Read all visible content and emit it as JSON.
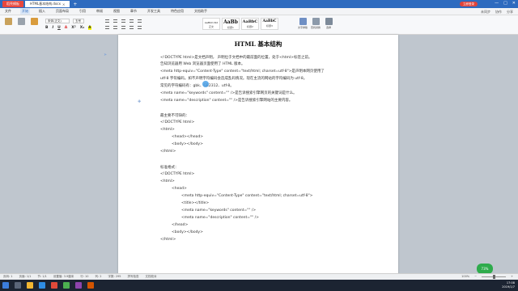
{
  "titlebar": {
    "app_tab": "稻壳模板",
    "doc_tab": "HTML基本结构.docx",
    "login": "立即登录",
    "controls": [
      "—",
      "□",
      "✕"
    ]
  },
  "menubar": {
    "items": [
      "文件",
      "开始",
      "插入",
      "页面布局",
      "引用",
      "审阅",
      "视图",
      "章节",
      "开发工具",
      "特色应用",
      "文档助手"
    ],
    "active_index": 1,
    "right": [
      "未同步",
      "协作",
      "分享"
    ]
  },
  "ribbon": {
    "font_name": "宋体(正文)",
    "font_size": "五号",
    "format_buttons": [
      "B",
      "I",
      "U",
      "A",
      "X²",
      "X₂",
      "A"
    ],
    "styles": [
      {
        "sample": "AaBbCcDd",
        "name": "正文"
      },
      {
        "sample": "AaBb",
        "name": "标题1"
      },
      {
        "sample": "AaBbC",
        "name": "标题2"
      },
      {
        "sample": "AaBbC",
        "name": "标题3"
      }
    ],
    "right_buttons": [
      "文字排版",
      "查找替换",
      "选择"
    ]
  },
  "document": {
    "title": "HTML 基本结构",
    "lines": [
      "<!DOCTYPE html>是文档声明，  声明位于文档中的最前面的位置，处于<html>标签之前。",
      "告知浏览器用 Web 浏览器页面使用了 HTML 版本。",
      "<meta http-equiv=\"Content-Type\" content=\"text/html; charset=utf-8\">是声明本网页使用了",
      "utf-8 字符编码。如不声明字符编码会造成乱码情况。现在主流的网站的字符编码为 utf-8。",
      "常见的字符编码有：gbk、GB2312、utf-8。",
      "<meta name=\"keywords\" content=\"\" />是告诉搜索引擎网页的关键词是什么。",
      "<meta name=\"description\" content=\"\" />是告诉搜索引擎网站的主要内容。",
      "",
      "最主要不可缺的：",
      "<!DOCTYPE html>",
      "<html>",
      "<head></head>",
      "<body></body>",
      "</html>",
      "",
      "标准格式：",
      "<!DOCTYPE html>",
      "<html>",
      "<head>",
      "<meta http-equiv=\"Content-Type\" content=\"text/html; charset=utf-8\">",
      "<title></title>",
      "<meta name=\"keywords\" content=\"\" />",
      "<meta name=\"description\" content=\"\" />",
      "</head>",
      "<body></body>",
      "</html>"
    ]
  },
  "statusbar": {
    "left": [
      "页码: 1",
      "页面: 1/1",
      "节: 1/1",
      "设置值: 3.9厘米",
      "行: 10",
      "列: 2",
      "字数: 295",
      "拼写检查",
      "文档校对"
    ],
    "zoom": "100%"
  },
  "badge": "73%",
  "tray": {
    "time": "17:08",
    "date": "2019/1/7"
  },
  "colors": {
    "accent": "#2e6bbf",
    "brand_red": "#e9473d",
    "badge_green": "#2eab4c"
  }
}
